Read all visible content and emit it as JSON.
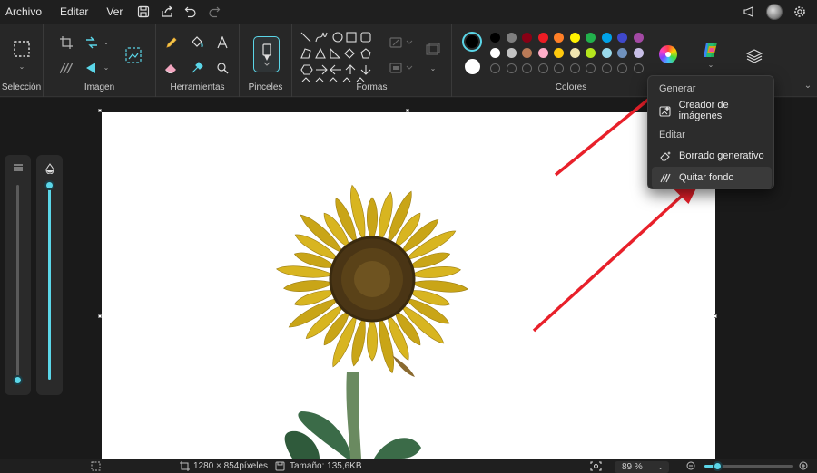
{
  "menubar": {
    "items": [
      "Archivo",
      "Editar",
      "Ver"
    ],
    "icons": [
      "save-icon",
      "share-icon",
      "undo-icon",
      "redo-icon"
    ],
    "right_icons": [
      "megaphone-icon",
      "avatar",
      "gear-icon"
    ]
  },
  "ribbon": {
    "groups": {
      "seleccion": "Selección",
      "imagen": "Imagen",
      "herramientas": "Herramientas",
      "pinceles": "Pinceles",
      "formas": "Formas",
      "colores": "Colores"
    },
    "palette_row1": [
      "#000000",
      "#7f7f7f",
      "#880015",
      "#ed1c24",
      "#ff7f27",
      "#fff200",
      "#22b14c",
      "#00a2e8",
      "#3f48cc",
      "#a349a4"
    ],
    "palette_row2": [
      "#ffffff",
      "#c3c3c3",
      "#b97a57",
      "#ffaec9",
      "#ffc90e",
      "#efe4b0",
      "#b5e61d",
      "#99d9ea",
      "#7092be",
      "#c8bfe7"
    ],
    "primary_color": "#000000",
    "secondary_color": "#ffffff"
  },
  "dropdown": {
    "section_generar": "Generar",
    "item_creador": "Creador de imágenes",
    "section_editar": "Editar",
    "item_borrado": "Borrado generativo",
    "item_quitar": "Quitar fondo"
  },
  "statusbar": {
    "dimensions": "1280 × 854píxeles",
    "size": "Tamaño: 135,6KB",
    "zoom": "89 %"
  },
  "sliders": {
    "size_level": 0.0,
    "opacity_level": 1.0
  },
  "colors": {
    "accent": "#5bd6e8",
    "arrow": "#e8202a"
  }
}
